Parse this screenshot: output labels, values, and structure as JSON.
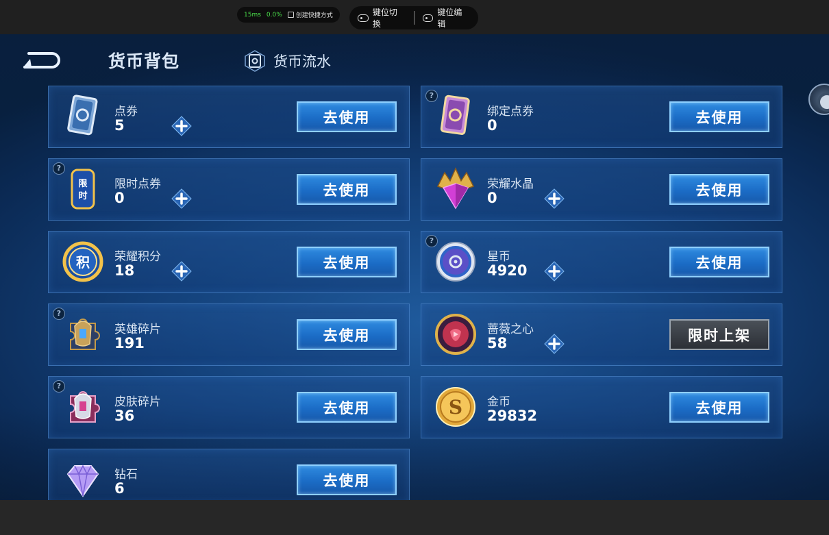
{
  "overlay": {
    "latency": "15ms",
    "loss": "0.0%",
    "shortcut_label": "创建快捷方式",
    "key_switch_label": "键位切换",
    "key_edit_label": "键位编辑"
  },
  "header": {
    "title": "货币背包",
    "flow_tab": "货币流水"
  },
  "use_label": "去使用",
  "limited_label": "限时上架",
  "currencies": [
    {
      "name": "点券",
      "value": "5",
      "icon": "ticket-blue-icon"
    },
    {
      "name": "绑定点券",
      "value": "0",
      "icon": "ticket-purple-icon"
    },
    {
      "name": "限时点券",
      "value": "0",
      "icon": "limited-ticket-icon",
      "icon_text": "限时"
    },
    {
      "name": "荣耀水晶",
      "value": "0",
      "icon": "glory-crystal-icon"
    },
    {
      "name": "荣耀积分",
      "value": "18",
      "icon": "glory-points-icon",
      "icon_text": "积"
    },
    {
      "name": "星币",
      "value": "4920",
      "icon": "star-coin-icon"
    },
    {
      "name": "英雄碎片",
      "value": "191",
      "icon": "hero-fragment-icon"
    },
    {
      "name": "蔷薇之心",
      "value": "58",
      "icon": "rose-heart-icon"
    },
    {
      "name": "皮肤碎片",
      "value": "36",
      "icon": "skin-fragment-icon"
    },
    {
      "name": "金币",
      "value": "29832",
      "icon": "gold-coin-icon",
      "icon_text": "S"
    },
    {
      "name": "钻石",
      "value": "6",
      "icon": "diamond-icon"
    }
  ],
  "colors": {
    "use_button": "#1b6cc6",
    "limited_button": "#3a3f46",
    "background": "#134079"
  }
}
